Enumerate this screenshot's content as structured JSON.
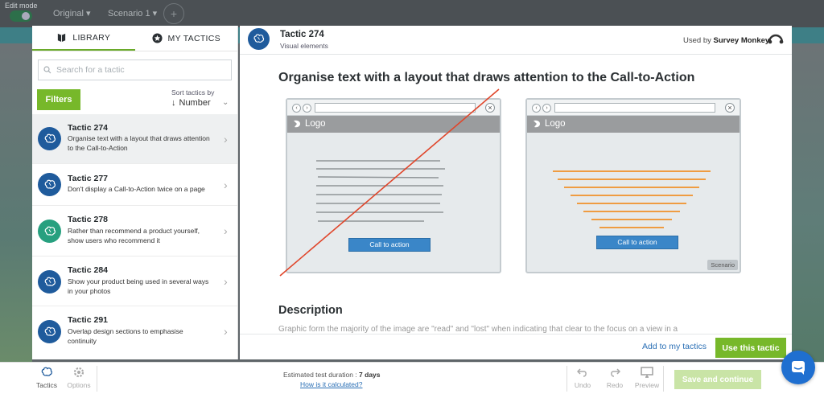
{
  "background": {
    "edit_mode": "Edit mode",
    "original": "Original",
    "scenario": "Scenario 1"
  },
  "sidebar": {
    "tabs": [
      {
        "label": "LIBRARY",
        "icon": "book-icon"
      },
      {
        "label": "MY TACTICS",
        "icon": "star-icon"
      }
    ],
    "search_placeholder": "Search for a tactic",
    "filters_label": "Filters",
    "sort_label": "Sort tactics by",
    "sort_value": "Number",
    "items": [
      {
        "title": "Tactic 274",
        "desc": "Organise text with a layout that draws attention to the Call-to-Action"
      },
      {
        "title": "Tactic 277",
        "desc": "Don't display a Call-to-Action twice on a page"
      },
      {
        "title": "Tactic 278",
        "desc": "Rather than recommend a product yourself, show users who recommend it"
      },
      {
        "title": "Tactic 284",
        "desc": "Show your product being used in several ways in your photos"
      },
      {
        "title": "Tactic 291",
        "desc": "Overlap design sections to emphasise continuity"
      }
    ]
  },
  "main": {
    "title": "Tactic 274",
    "subtitle": "Visual elements",
    "used_by_prefix": "Used by",
    "used_by_name": "Survey Monkey",
    "heading": "Organise text with a layout that draws attention to the Call-to-Action",
    "logo_text": "Logo",
    "cta_label": "Call to action",
    "scenario_badge": "Scenario",
    "description_heading": "Description",
    "description_text": "Graphic form the majority of the image are \"read\" and \"lost\" when indicating that clear to the focus on a view in a",
    "add_link": "Add to my tactics",
    "use_button": "Use this tactic"
  },
  "toolbar": {
    "tactics": "Tactics",
    "options": "Options",
    "duration_label": "Estimated test duration :",
    "duration_value": "7 days",
    "calc_link": "How is it calculated?",
    "undo": "Undo",
    "redo": "Redo",
    "preview": "Preview",
    "save": "Save and continue"
  },
  "colors": {
    "accent_green": "#77b82a",
    "tactic_blue": "#1f5b9c",
    "link_blue": "#2a6fb5",
    "cta_blue": "#3a86c8",
    "strike_red": "#e0462b",
    "text_line_orange": "#f0902a"
  }
}
